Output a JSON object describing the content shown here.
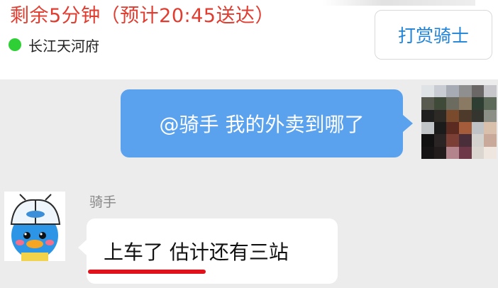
{
  "header": {
    "title": "剩余5分钟（预计20:45送达）",
    "status_text": "长江天河府",
    "status_color": "#2fcf36",
    "tip_button_label": "打赏骑士"
  },
  "chat": {
    "messages": [
      {
        "direction": "outgoing",
        "text": "@骑手 我的外卖到哪了",
        "avatar": "pixelated-avatar"
      },
      {
        "direction": "incoming",
        "sender": "骑手",
        "text": "上车了 估计还有三站",
        "avatar": "rider-avatar"
      }
    ]
  },
  "colors": {
    "accent_red": "#e03c2f",
    "outgoing_bubble": "#5aa2ee",
    "tip_button_text": "#1f84d9",
    "annotation_underline": "#e0121b"
  }
}
